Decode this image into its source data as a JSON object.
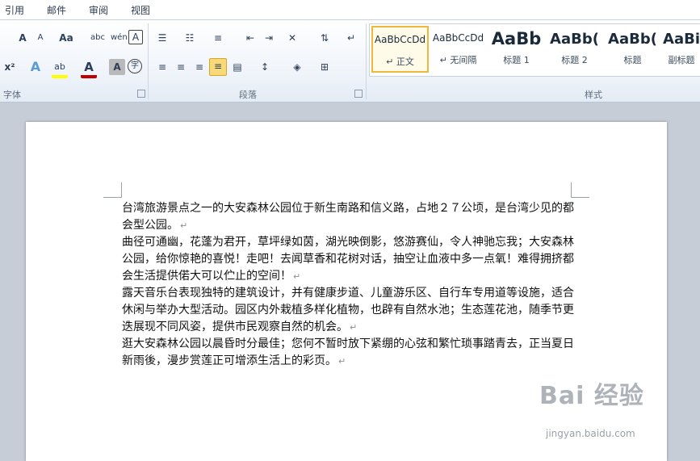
{
  "tabs": [
    "引用",
    "邮件",
    "审阅",
    "视图"
  ],
  "ribbon": {
    "font_group_label": "字体",
    "paragraph_group_label": "段落",
    "styles_group_label": "样式",
    "font_buttons": {
      "grow": "A",
      "shrink": "A",
      "case": "Aa",
      "clear_format": "abc",
      "phonetic": "wén",
      "border": "A",
      "subscript_superscript": "x²",
      "text_effect": "A",
      "highlight": "ab",
      "font_color": "A",
      "shading": "A",
      "enclose": "字"
    },
    "styles": [
      {
        "preview": "AaBbCcDd",
        "name": "↵ 正文"
      },
      {
        "preview": "AaBbCcDd",
        "name": "↵ 无间隔"
      },
      {
        "preview": "AaBb",
        "name": "标题 1"
      },
      {
        "preview": "AaBb(",
        "name": "标题 2"
      },
      {
        "preview": "AaBb(",
        "name": "标题"
      },
      {
        "preview": "AaBi",
        "name": "副标题"
      }
    ],
    "colors": {
      "highlight": "#ffff00",
      "font_color": "#c00000",
      "accent": "#f0b73c"
    }
  },
  "document": {
    "paragraphs": [
      "台湾旅游景点之一的大安森林公园位于新生南路和信义路，占地２７公顷，是台湾少见的都会型公园。",
      "曲径可通幽，花蓬为君开，草坪绿如茵，湖光映倒影，悠游赛仙，令人神驰忘我；大安森林公园，给你惊艳的喜悦！走吧！去闻草香和花树对话，抽空让血液中多一点氧！难得拥挤都会生活提供偌大可以伫止的空间！",
      "露天音乐台表现独特的建筑设计，并有健康步道、儿童游乐区、自行车专用道等设施，适合休闲与举办大型活动。园区内外栽植多样化植物，也辟有自然水池；生态莲花池，随季节更迭展现不同风姿，提供市民观察自然的机会。",
      "逛大安森林公园以晨昏时分最佳；您何不暂时放下紧绷的心弦和繁忙琐事踏青去，正当夏日新雨後，漫步赏莲正可增添生活上的彩页。"
    ],
    "paragraph_mark": "↵"
  },
  "watermark": {
    "text": "Bai 经验",
    "url": "jingyan.baidu.com"
  }
}
